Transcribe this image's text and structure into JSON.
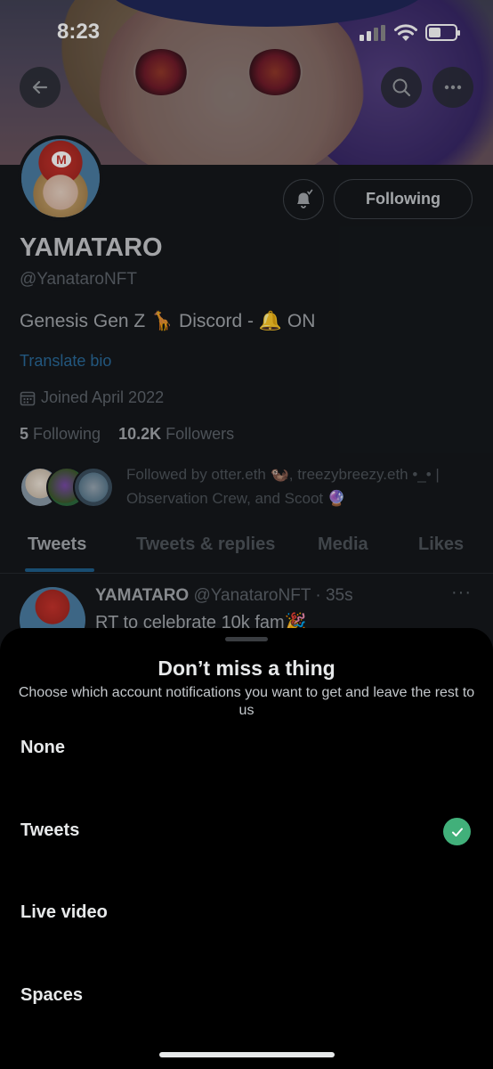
{
  "status_bar": {
    "time": "8:23",
    "battery_level": 0.45
  },
  "profile": {
    "display_name": "YAMATARO",
    "handle": "@YanataroNFT",
    "bio": "Genesis Gen Z 🦒 Discord - 🔔 ON",
    "translate_label": "Translate bio",
    "joined": "Joined April 2022",
    "following_count": "5",
    "following_label": "Following",
    "followers_count": "10.2K",
    "followers_label": "Followers",
    "followed_by": "Followed by otter.eth 🦦, treezybreezy.eth •_• | Observation Crew, and Scoot 🔮",
    "following_button": "Following"
  },
  "tabs": [
    "Tweets",
    "Tweets & replies",
    "Media",
    "Likes"
  ],
  "tweet": {
    "name": "YAMATARO",
    "meta": "@YanataroNFT · 35s",
    "text": "RT to celebrate 10k fam🎉",
    "more": "···"
  },
  "sheet": {
    "title": "Don’t miss a thing",
    "subtitle": "Choose which account notifications you want to get and leave the rest to us",
    "options": [
      {
        "label": "None",
        "selected": false
      },
      {
        "label": "Tweets",
        "selected": true
      },
      {
        "label": "Live video",
        "selected": false
      },
      {
        "label": "Spaces",
        "selected": false
      }
    ]
  },
  "colors": {
    "accent_check": "#41b07a",
    "link": "#1d9bf0",
    "sheet_bg": "#000000"
  },
  "icons": [
    "back-arrow-icon",
    "search-icon",
    "more-icon",
    "bell-icon",
    "calendar-icon",
    "check-icon"
  ]
}
